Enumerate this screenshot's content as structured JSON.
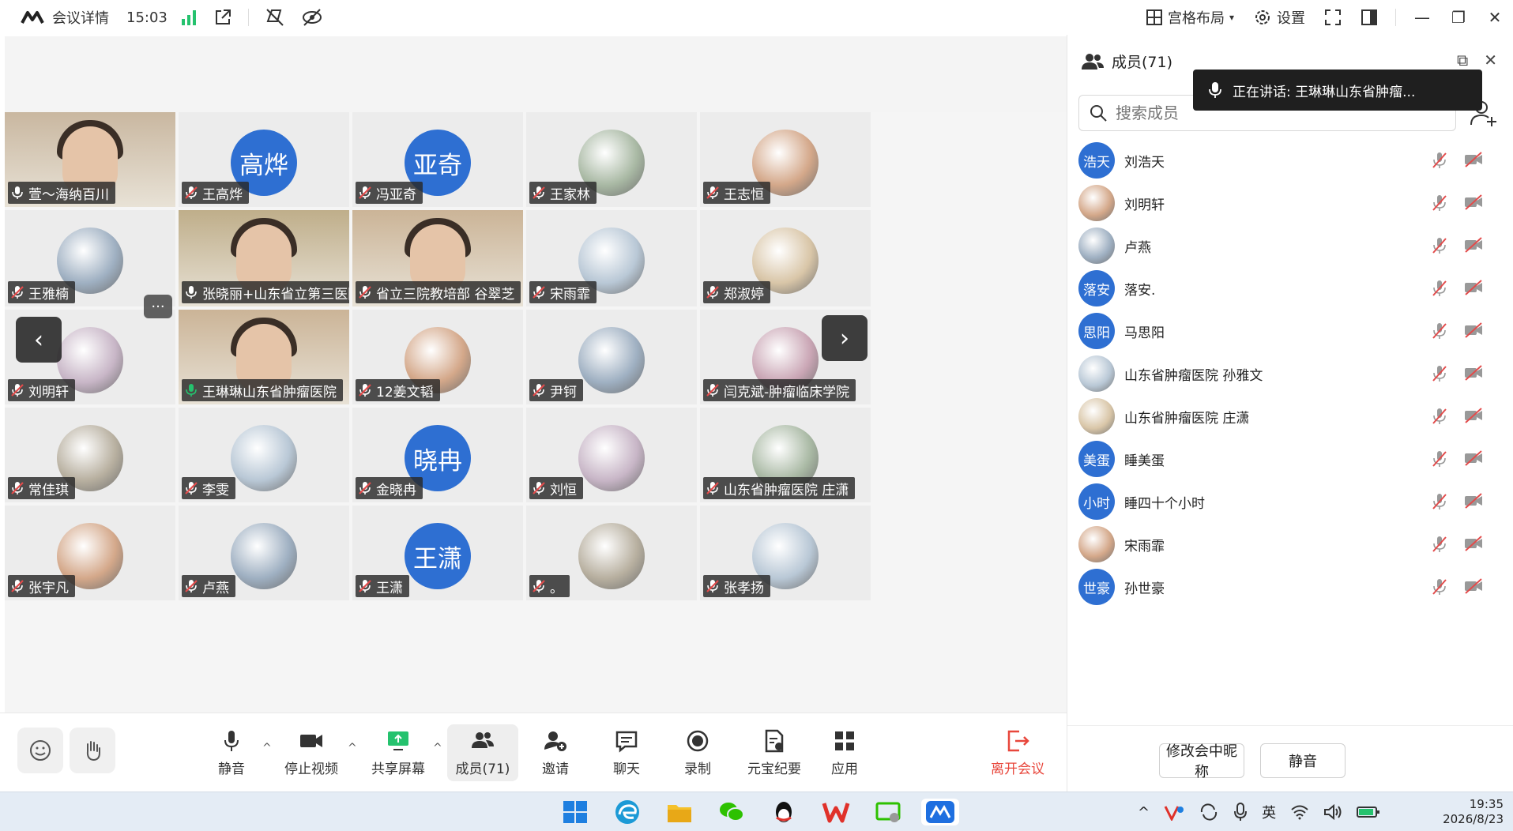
{
  "titlebar": {
    "app_title": "会议详情",
    "time": "15:03",
    "layout_label": "宫格布局",
    "settings_label": "设置"
  },
  "speaking_banner": {
    "text": "正在讲话:  王琳琳山东省肿瘤..."
  },
  "tiles": [
    {
      "name": "萱～海纳百川",
      "type": "video",
      "mic": "on"
    },
    {
      "name": "王高烨",
      "type": "initials",
      "initials": "高烨",
      "mic": "muted"
    },
    {
      "name": "冯亚奇",
      "type": "initials",
      "initials": "亚奇",
      "mic": "muted"
    },
    {
      "name": "王家林",
      "type": "photo",
      "mic": "muted"
    },
    {
      "name": "王志恒",
      "type": "photo",
      "mic": "muted"
    },
    {
      "name": "王雅楠",
      "type": "photo",
      "mic": "muted"
    },
    {
      "name": "张晓丽+山东省立第三医院",
      "type": "video",
      "mic": "on"
    },
    {
      "name": "省立三院教培部 谷翠芝",
      "type": "video",
      "mic": "muted"
    },
    {
      "name": "宋雨霏",
      "type": "photo",
      "mic": "muted"
    },
    {
      "name": "郑淑婷",
      "type": "photo",
      "mic": "muted"
    },
    {
      "name": "刘明轩",
      "type": "photo",
      "mic": "muted"
    },
    {
      "name": "王琳琳山东省肿瘤医院",
      "type": "video",
      "mic": "speaking",
      "active": true
    },
    {
      "name": "12姜文韬",
      "type": "photo",
      "mic": "muted"
    },
    {
      "name": "尹钶",
      "type": "photo",
      "mic": "muted"
    },
    {
      "name": "闫克斌-肿瘤临床学院",
      "type": "photo",
      "mic": "muted"
    },
    {
      "name": "常佳琪",
      "type": "photo",
      "mic": "muted"
    },
    {
      "name": "李雯",
      "type": "photo",
      "mic": "muted"
    },
    {
      "name": "金晓冉",
      "type": "initials",
      "initials": "晓冉",
      "mic": "muted"
    },
    {
      "name": "刘恒",
      "type": "photo",
      "mic": "muted"
    },
    {
      "name": "山东省肿瘤医院 庄潇",
      "type": "photo",
      "mic": "muted"
    },
    {
      "name": "张宇凡",
      "type": "photo",
      "mic": "muted"
    },
    {
      "name": "卢燕",
      "type": "photo",
      "mic": "muted"
    },
    {
      "name": "王潇",
      "type": "initials",
      "initials": "王潇",
      "mic": "muted"
    },
    {
      "name": "。",
      "type": "photo",
      "mic": "muted"
    },
    {
      "name": "张孝扬",
      "type": "photo",
      "mic": "muted"
    }
  ],
  "toolbar": {
    "mute": "静音",
    "stop_video": "停止视频",
    "share_screen": "共享屏幕",
    "members": "成员(71)",
    "invite": "邀请",
    "chat": "聊天",
    "record": "录制",
    "ai_minutes": "元宝纪要",
    "apps": "应用",
    "leave": "离开会议"
  },
  "panel": {
    "title": "成员(71)",
    "search_placeholder": "搜索成员",
    "members": [
      {
        "name": "刘浩天",
        "initials": "浩天",
        "avatar": "initials"
      },
      {
        "name": "刘明轩",
        "initials": "",
        "avatar": "photo"
      },
      {
        "name": "卢燕",
        "initials": "",
        "avatar": "photo"
      },
      {
        "name": "落安.",
        "initials": "落安",
        "avatar": "initials"
      },
      {
        "name": "马思阳",
        "initials": "思阳",
        "avatar": "initials"
      },
      {
        "name": "山东省肿瘤医院 孙雅文",
        "initials": "",
        "avatar": "photo"
      },
      {
        "name": "山东省肿瘤医院 庄潇",
        "initials": "",
        "avatar": "photo"
      },
      {
        "name": "睡美蛋",
        "initials": "美蛋",
        "avatar": "initials"
      },
      {
        "name": "睡四十个小时",
        "initials": "小时",
        "avatar": "initials"
      },
      {
        "name": "宋雨霏",
        "initials": "",
        "avatar": "photo"
      },
      {
        "name": "孙世豪",
        "initials": "世豪",
        "avatar": "initials"
      }
    ],
    "rename_button": "修改会中昵称",
    "mute_button": "静音"
  },
  "taskbar": {
    "ime": "英",
    "time": "19:35",
    "date": "2026/8/23"
  },
  "colors": {
    "accent_blue": "#2e6fd2",
    "active_green": "#25c26e",
    "leave_red": "#e8473c",
    "muted_red": "#e24b4b"
  }
}
